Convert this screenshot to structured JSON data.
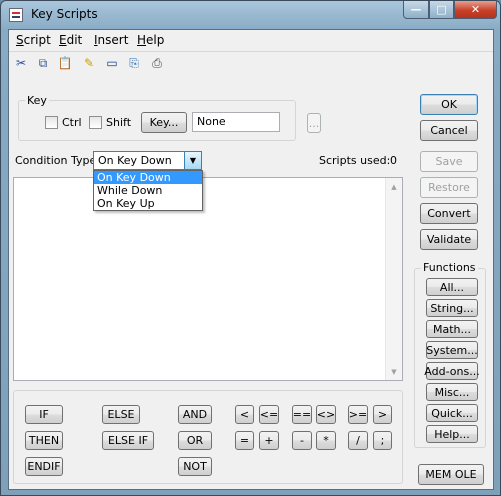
{
  "window": {
    "title": "Key Scripts",
    "min_glyph": "—",
    "max_glyph": "□",
    "close_glyph": "✕"
  },
  "menu": {
    "items": [
      {
        "u": "S",
        "rest": "cript"
      },
      {
        "u": "E",
        "rest": "dit"
      },
      {
        "u": "I",
        "rest": "nsert"
      },
      {
        "u": "H",
        "rest": "elp"
      }
    ]
  },
  "toolbar": {
    "icons": [
      "cut-icon",
      "copy-icon",
      "paste-icon",
      "highlight-icon",
      "window-icon",
      "tag-icon",
      "print-icon"
    ],
    "glyphs": [
      "✂",
      "⧉",
      "📋",
      "✎",
      "▭",
      "⎘",
      "⎙"
    ]
  },
  "key_group": {
    "legend": "Key",
    "ctrl_label": "Ctrl",
    "shift_label": "Shift",
    "key_button": "Key...",
    "key_value": "None",
    "browse_button": "..."
  },
  "condition": {
    "label": "Condition Type:",
    "selected": "On Key Down",
    "options": [
      "On Key Down",
      "While Down",
      "On Key Up"
    ]
  },
  "scripts_used": {
    "label": "Scripts used:",
    "value": "0"
  },
  "right_buttons": {
    "ok": "OK",
    "cancel": "Cancel",
    "save": "Save",
    "restore": "Restore",
    "convert": "Convert",
    "validate": "Validate"
  },
  "functions": {
    "title": "Functions",
    "buttons": [
      "All...",
      "String...",
      "Math...",
      "System...",
      "Add-ons...",
      "Misc...",
      "Quick...",
      "Help..."
    ]
  },
  "mem_ole": "MEM OLE",
  "operators": {
    "keywords": [
      "IF",
      "ELSE",
      "AND",
      "THEN",
      "ELSE IF",
      "OR",
      "ENDIF",
      "NOT"
    ],
    "symbols": [
      "<",
      "<=",
      "==",
      "<>",
      ">=",
      ">",
      "=",
      "+",
      "-",
      "*",
      "/",
      ";"
    ]
  }
}
